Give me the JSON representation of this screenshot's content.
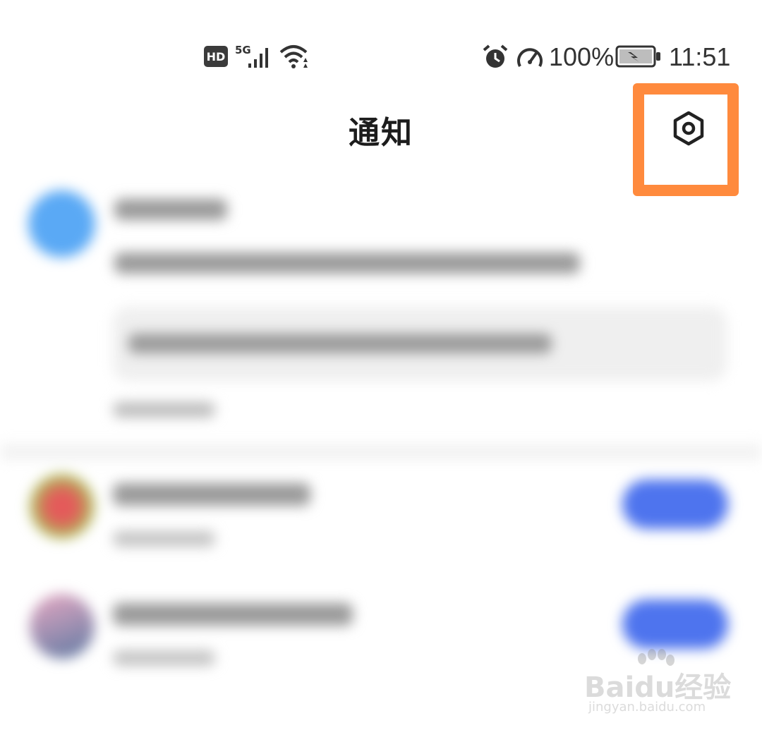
{
  "status_bar": {
    "hd_badge": "HD",
    "network_label": "5G",
    "battery_percent": "100%",
    "time": "11:51",
    "icons": [
      "signal-icon",
      "wifi-icon",
      "alarm-icon",
      "speedometer-icon",
      "battery-charging-icon"
    ]
  },
  "header": {
    "title": "通知",
    "settings_icon": "settings-hexagon-icon"
  },
  "annotation": {
    "highlight_color": "#ff8a3d"
  },
  "accent_color": "#4e74ee",
  "watermark": {
    "brand": "Baidu经验",
    "url": "jingyan.baidu.com"
  }
}
